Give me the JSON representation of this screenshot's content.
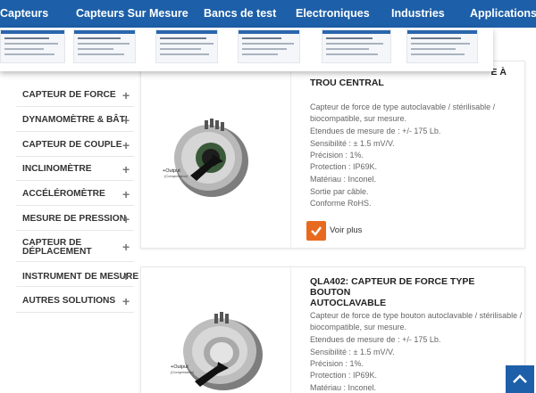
{
  "nav": {
    "items": [
      "Capteurs",
      "Capteurs Sur Mesure",
      "Bancs de test",
      "Electroniques",
      "Industries",
      "Applications"
    ]
  },
  "sidebar": {
    "items": [
      {
        "label": "CAPTEUR DE FORCE"
      },
      {
        "label": "DYNAMOMÈTRE & BÂTI"
      },
      {
        "label": "CAPTEUR DE COUPLE"
      },
      {
        "label": "INCLINOMÈTRE"
      },
      {
        "label": "ACCÉLÉROMÈTRE"
      },
      {
        "label": "MESURE DE PRESSION"
      },
      {
        "label": "CAPTEUR DE",
        "label2": "DÉPLACEMENT"
      },
      {
        "label": "INSTRUMENT DE MESURE"
      },
      {
        "label": "AUTRES SOLUTIONS"
      }
    ],
    "expand_symbol": "+"
  },
  "products": [
    {
      "title_line1": "",
      "title_line2": "TROU CENTRAL",
      "title_fragment": "E À",
      "image_label": "+Output",
      "image_sublabel": "(Compression)",
      "description_line1": "Capteur de force de type autoclavable / stérilisable /",
      "description_line2": "biocompatible, sur mesure.",
      "specs": [
        "Etendues de mesure de : +/- 175 Lb.",
        "Sensibilité : ± 1.5 mV/V.",
        "Précision : 1%.",
        "Protection : IP69K.",
        "Matériau : Inconel.",
        "Sortie par câble.",
        "Conforme RoHS."
      ],
      "voir_plus": "Voir plus"
    },
    {
      "title_line1": "QLA402: CAPTEUR DE FORCE TYPE BOUTON",
      "title_line2": "AUTOCLAVABLE",
      "image_label": "+Output",
      "image_sublabel": "(Compression)",
      "description_line1": "Capteur de force de type bouton autoclavable / stérilisable /",
      "description_line2": "biocompatible, sur mesure.",
      "specs": [
        "Etendues de mesure de : +/- 175 Lb.",
        "Sensibilité : ± 1.5 mV/V.",
        "Précision : 1%.",
        "Protection : IP69K.",
        "Matériau : Inconel."
      ]
    }
  ],
  "colors": {
    "nav_bg": "#1d5fa8",
    "accent": "#e86a1e"
  },
  "icons": {
    "check": "check-icon",
    "expand": "plus-icon",
    "scroll_top": "chevron-up-icon"
  }
}
